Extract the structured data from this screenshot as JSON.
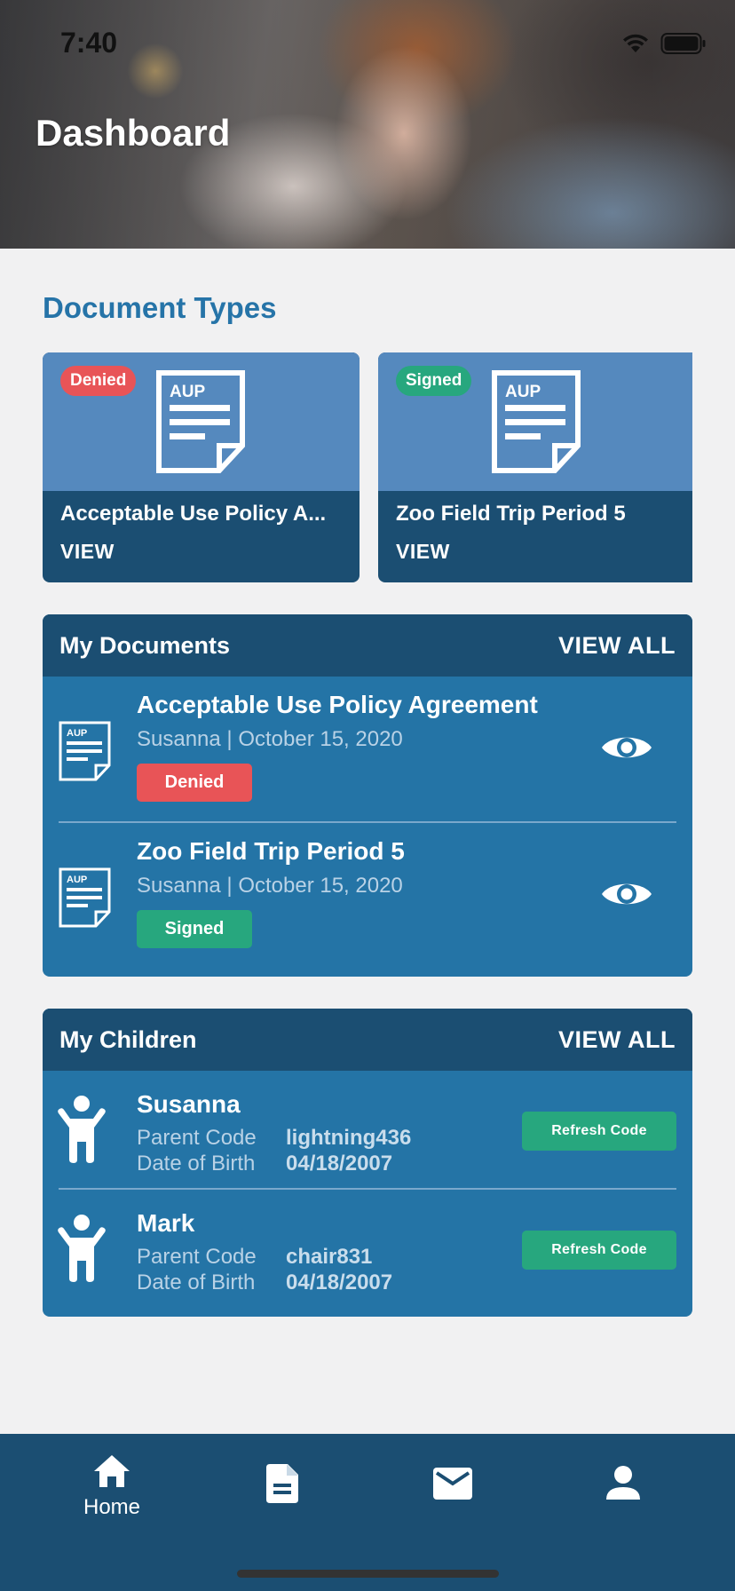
{
  "status_bar": {
    "time": "7:40"
  },
  "header": {
    "title": "Dashboard"
  },
  "document_types": {
    "title": "Document Types",
    "cards": [
      {
        "badge": "Denied",
        "icon_label": "AUP",
        "name": "Acceptable Use Policy A...",
        "action": "VIEW"
      },
      {
        "badge": "Signed",
        "icon_label": "AUP",
        "name": "Zoo Field Trip Period 5",
        "action": "VIEW"
      }
    ]
  },
  "my_documents": {
    "title": "My Documents",
    "view_all": "VIEW ALL",
    "items": [
      {
        "icon_label": "AUP",
        "title": "Acceptable Use Policy Agreement",
        "subtitle": "Susanna | October 15, 2020",
        "status": "Denied"
      },
      {
        "icon_label": "AUP",
        "title": "Zoo Field Trip Period 5",
        "subtitle": "Susanna | October 15, 2020",
        "status": "Signed"
      }
    ]
  },
  "my_children": {
    "title": "My Children",
    "view_all": "VIEW ALL",
    "parent_code_label": "Parent Code",
    "dob_label": "Date of Birth",
    "refresh_label": "Refresh Code",
    "items": [
      {
        "name": "Susanna",
        "parent_code": "lightning436",
        "dob": "04/18/2007"
      },
      {
        "name": "Mark",
        "parent_code": "chair831",
        "dob": "04/18/2007"
      }
    ]
  },
  "bottom_nav": {
    "items": [
      {
        "icon": "home-icon",
        "label": "Home"
      },
      {
        "icon": "document-icon",
        "label": ""
      },
      {
        "icon": "mail-icon",
        "label": ""
      },
      {
        "icon": "person-icon",
        "label": ""
      }
    ]
  },
  "colors": {
    "primary_dark": "#1b4e72",
    "primary": "#2474a6",
    "card_light": "#5589be",
    "title_blue": "#2674a8",
    "denied": "#e85457",
    "signed": "#27a77e"
  }
}
